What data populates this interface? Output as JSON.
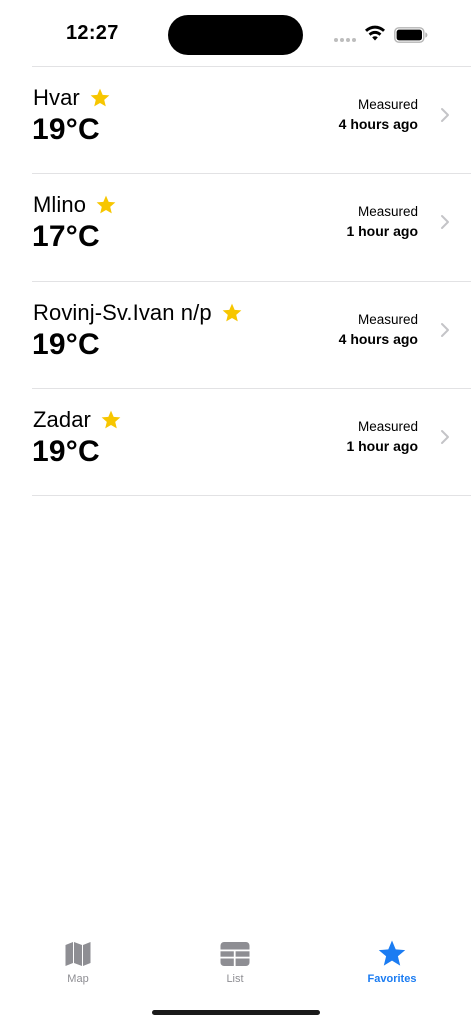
{
  "status_bar": {
    "time": "12:27"
  },
  "favorites": [
    {
      "name": "Hvar",
      "temperature": "19°C",
      "measured_label": "Measured",
      "measured_ago": "4 hours ago",
      "favorite": true
    },
    {
      "name": "Mlino",
      "temperature": "17°C",
      "measured_label": "Measured",
      "measured_ago": "1 hour ago",
      "favorite": true
    },
    {
      "name": "Rovinj-Sv.Ivan n/p",
      "temperature": "19°C",
      "measured_label": "Measured",
      "measured_ago": "4 hours ago",
      "favorite": true
    },
    {
      "name": "Zadar",
      "temperature": "19°C",
      "measured_label": "Measured",
      "measured_ago": "1 hour ago",
      "favorite": true
    }
  ],
  "tab_bar": {
    "tabs": [
      {
        "label": "Map",
        "icon": "map-icon",
        "active": false
      },
      {
        "label": "List",
        "icon": "list-icon",
        "active": false
      },
      {
        "label": "Favorites",
        "icon": "star-icon",
        "active": true
      }
    ]
  },
  "colors": {
    "star": "#f7c600",
    "active_tab": "#1b7cf2",
    "inactive_tab": "#8e8e93",
    "chevron": "#c4c4c7",
    "separator": "#e2e2e4"
  }
}
